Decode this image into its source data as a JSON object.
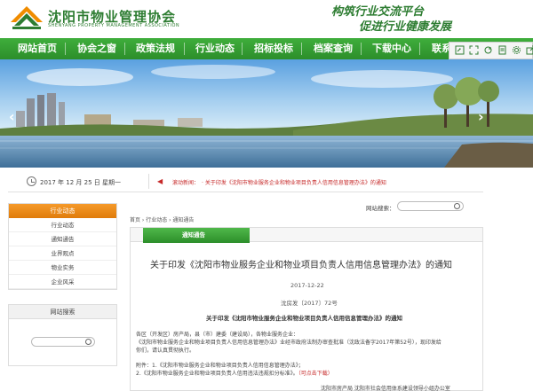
{
  "header": {
    "brand_cn": "沈阳市物业管理协会",
    "brand_en": "SHENYANG PROPERTY MANAGEMENT ASSOCIATION",
    "slogan_line1": "构筑行业交流平台",
    "slogan_line2": "促进行业健康发展"
  },
  "nav": {
    "items": [
      {
        "label": "网站首页"
      },
      {
        "label": "协会之窗"
      },
      {
        "label": "政策法规"
      },
      {
        "label": "行业动态"
      },
      {
        "label": "招标投标"
      },
      {
        "label": "档案查询"
      },
      {
        "label": "下载中心"
      },
      {
        "label": "联系"
      }
    ],
    "toolbar_icons": [
      "share-icon",
      "expand-icon",
      "refresh-icon",
      "document-icon",
      "settings-icon",
      "export-icon"
    ]
  },
  "infobar": {
    "date": "2017 年 12 月 25 日 星期一",
    "news_label": "滚动新闻：",
    "news_text": "· 关于印发《沈阳市物业服务企业和物业项目负责人信用信息管理办法》的通知"
  },
  "sidebar": {
    "header": "行业动态",
    "items": [
      {
        "label": "行业动态"
      },
      {
        "label": "通知通告"
      },
      {
        "label": "业界观点"
      },
      {
        "label": "物业实务"
      },
      {
        "label": "企业风采"
      }
    ],
    "search_header": "网站搜索"
  },
  "main": {
    "site_search_label": "网站搜索：",
    "breadcrumb": "首页 › 行业动态 › 通知通告",
    "tab_label": "通知通告",
    "article": {
      "title": "关于印发《沈阳市物业服务企业和物业项目负责人信用信息管理办法》的通知",
      "date": "2017-12-22",
      "doc_no": "沈房发〔2017〕72号",
      "subtitle": "关于印发《沈阳市物业服务企业和物业项目负责人信用信息管理办法》的通知",
      "para1": "各区（开发区）房产局，县（市）建委（建设局），各物业服务企业：",
      "para2": "《沈阳市物业服务企业和物业项目负责人信用信息管理办法》业经市政府法制办审查批准（沈政法备字2017年第52号），现印发给",
      "para3": "你们，请认真贯彻执行。",
      "attach1": "附件：1.《沈阳市物业服务企业和物业项目负责人信用信息管理办法》；",
      "attach2_a": "2.《沈阳市物业服务企业和物业项目负责人信用违法违规扣分标准》。",
      "attach2_b": "（可点击下载）",
      "signature": "沈阳市房产局  沈阳市社会信用体系建设领导小组办公室"
    }
  },
  "colors": {
    "brand_green": "#2e7d32",
    "nav_green": "#3fae3c",
    "side_orange": "#f59a2a",
    "news_red": "#c62828"
  }
}
